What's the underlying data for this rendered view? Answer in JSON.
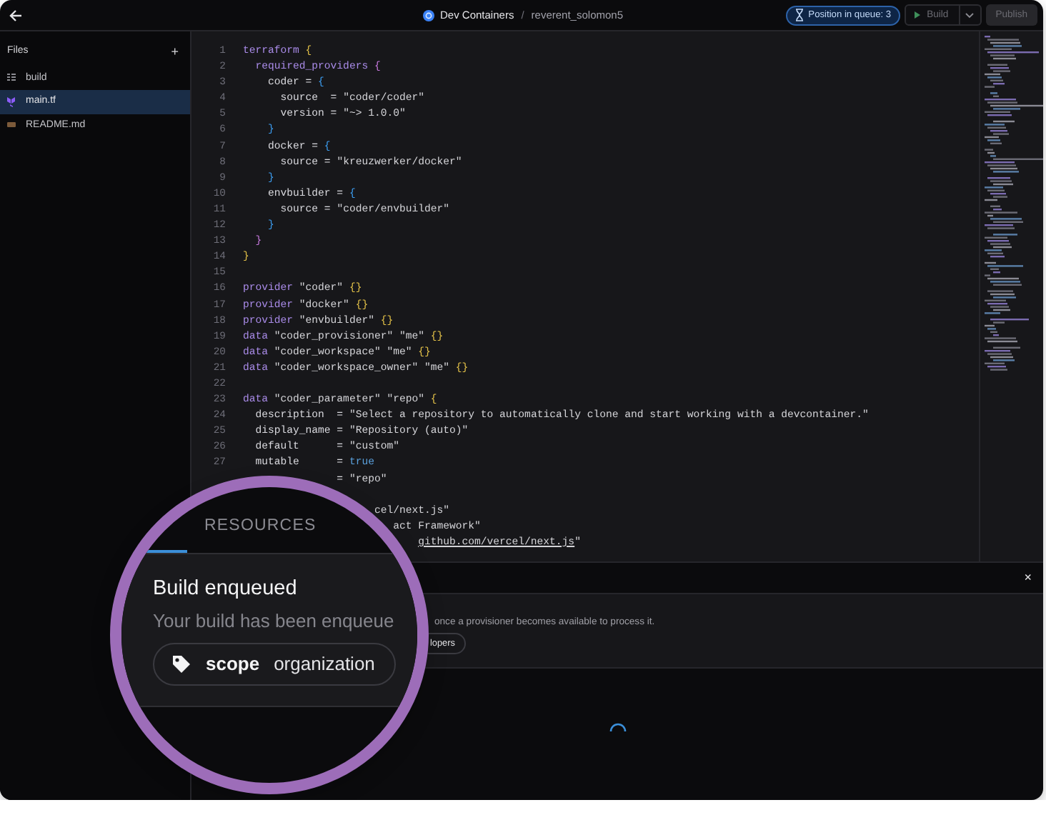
{
  "topbar": {
    "template": "Dev Containers",
    "separator": "/",
    "workspace": "reverent_solomon5",
    "queue_badge": "Position in queue: 3",
    "build_button": {
      "label": "Build",
      "disabled": true
    },
    "publish_button": {
      "label": "Publish",
      "disabled": true
    }
  },
  "sidebar": {
    "title": "Files",
    "add_button": "+",
    "files": [
      {
        "name": "build",
        "kind": "folder",
        "selected": false
      },
      {
        "name": "main.tf",
        "kind": "terraform",
        "selected": true
      },
      {
        "name": "README.md",
        "kind": "markdown",
        "selected": false
      }
    ]
  },
  "editor": {
    "lines": [
      {
        "number": "1",
        "tokens": [
          {
            "text": "terraform",
            "kind": "keyword"
          },
          {
            "text": " {",
            "kind": "brace",
            "color": "#e2c048"
          }
        ]
      },
      {
        "number": "2",
        "tokens": [
          {
            "text": "  required_providers",
            "kind": "keyword"
          },
          {
            "text": " {",
            "kind": "brace",
            "color": "#c678dd"
          }
        ]
      },
      {
        "number": "3",
        "tokens": [
          {
            "text": "    coder =",
            "kind": "plain"
          },
          {
            "text": " {",
            "kind": "brace",
            "color": "#3c9df0"
          }
        ]
      },
      {
        "number": "4",
        "tokens": [
          {
            "text": "      source  = ",
            "kind": "plain"
          },
          {
            "text": "\"coder/coder\"",
            "kind": "string"
          }
        ]
      },
      {
        "number": "5",
        "tokens": [
          {
            "text": "      version = ",
            "kind": "plain"
          },
          {
            "text": "\"~> 1.0.0\"",
            "kind": "string"
          }
        ]
      },
      {
        "number": "6",
        "tokens": [
          {
            "text": "    }",
            "kind": "brace",
            "color": "#3c9df0"
          }
        ]
      },
      {
        "number": "7",
        "tokens": [
          {
            "text": "    docker =",
            "kind": "plain"
          },
          {
            "text": " {",
            "kind": "brace",
            "color": "#3c9df0"
          }
        ]
      },
      {
        "number": "8",
        "tokens": [
          {
            "text": "      source = ",
            "kind": "plain"
          },
          {
            "text": "\"kreuzwerker/docker\"",
            "kind": "string"
          }
        ]
      },
      {
        "number": "9",
        "tokens": [
          {
            "text": "    }",
            "kind": "brace",
            "color": "#3c9df0"
          }
        ]
      },
      {
        "number": "10",
        "tokens": [
          {
            "text": "    envbuilder =",
            "kind": "plain"
          },
          {
            "text": " {",
            "kind": "brace",
            "color": "#3c9df0"
          }
        ]
      },
      {
        "number": "11",
        "tokens": [
          {
            "text": "      source = ",
            "kind": "plain"
          },
          {
            "text": "\"coder/envbuilder\"",
            "kind": "string"
          }
        ]
      },
      {
        "number": "12",
        "tokens": [
          {
            "text": "    }",
            "kind": "brace",
            "color": "#3c9df0"
          }
        ]
      },
      {
        "number": "13",
        "tokens": [
          {
            "text": "  }",
            "kind": "brace",
            "color": "#c678dd"
          }
        ]
      },
      {
        "number": "14",
        "tokens": [
          {
            "text": "}",
            "kind": "brace",
            "color": "#e2c048"
          }
        ]
      },
      {
        "number": "15"
      },
      {
        "number": "16",
        "tokens": [
          {
            "text": "provider",
            "kind": "keyword"
          },
          {
            "text": " \"coder\" ",
            "kind": "string"
          },
          {
            "text": "{}",
            "kind": "brace",
            "color": "#e2c048"
          }
        ]
      },
      {
        "number": "17",
        "tokens": [
          {
            "text": "provider",
            "kind": "keyword"
          },
          {
            "text": " \"docker\" ",
            "kind": "string"
          },
          {
            "text": "{}",
            "kind": "brace",
            "color": "#e2c048"
          }
        ]
      },
      {
        "number": "18",
        "tokens": [
          {
            "text": "provider",
            "kind": "keyword"
          },
          {
            "text": " \"envbuilder\" ",
            "kind": "string"
          },
          {
            "text": "{}",
            "kind": "brace",
            "color": "#e2c048"
          }
        ]
      },
      {
        "number": "19",
        "tokens": [
          {
            "text": "data",
            "kind": "keyword"
          },
          {
            "text": " \"coder_provisioner\" \"me\" ",
            "kind": "string"
          },
          {
            "text": "{}",
            "kind": "brace",
            "color": "#e2c048"
          }
        ]
      },
      {
        "number": "20",
        "tokens": [
          {
            "text": "data",
            "kind": "keyword"
          },
          {
            "text": " \"coder_workspace\" \"me\" ",
            "kind": "string"
          },
          {
            "text": "{}",
            "kind": "brace",
            "color": "#e2c048"
          }
        ]
      },
      {
        "number": "21",
        "tokens": [
          {
            "text": "data",
            "kind": "keyword"
          },
          {
            "text": " \"coder_workspace_owner\" \"me\" ",
            "kind": "string"
          },
          {
            "text": "{}",
            "kind": "brace",
            "color": "#e2c048"
          }
        ]
      },
      {
        "number": "22"
      },
      {
        "number": "23",
        "tokens": [
          {
            "text": "data",
            "kind": "keyword"
          },
          {
            "text": " \"coder_parameter\" \"repo\" ",
            "kind": "string"
          },
          {
            "text": "{",
            "kind": "brace",
            "color": "#e2c048"
          }
        ]
      },
      {
        "number": "24",
        "tokens": [
          {
            "text": "  description  = ",
            "kind": "plain"
          },
          {
            "text": "\"Select a repository to automatically clone and start working with a devcontainer.\"",
            "kind": "string"
          }
        ]
      },
      {
        "number": "25",
        "tokens": [
          {
            "text": "  display_name = ",
            "kind": "plain"
          },
          {
            "text": "\"Repository (auto)\"",
            "kind": "string"
          }
        ]
      },
      {
        "number": "26",
        "tokens": [
          {
            "text": "  default      = ",
            "kind": "plain"
          },
          {
            "text": "\"custom\"",
            "kind": "string"
          }
        ]
      },
      {
        "number": "27",
        "tokens": [
          {
            "text": "  mutable      = ",
            "kind": "plain"
          },
          {
            "text": "true",
            "kind": "boolean"
          }
        ]
      },
      {
        "tokens": [
          {
            "text": "= ",
            "kind": "plain"
          },
          {
            "text": "\"repo\"",
            "kind": "string"
          }
        ]
      },
      {
        "tokens": [
          {
            "text": "cel/next.js\"",
            "kind": "string"
          }
        ]
      },
      {
        "tokens": [
          {
            "text": "act Framework\"",
            "kind": "string"
          }
        ]
      },
      {
        "tokens": [
          {
            "text": "github.com/vercel/next.js",
            "kind": "link"
          },
          {
            "text": "\"",
            "kind": "string"
          }
        ]
      }
    ]
  },
  "bottom_panel": {
    "close_button": "×",
    "message": "once a provisioner becomes available to process it.",
    "chip": "lopers"
  },
  "magnifier": {
    "tabs": [
      {
        "selected": true
      },
      {
        "label": "RESOURCES",
        "selected": false
      }
    ],
    "title": "Build enqueued",
    "message": "Your build has been enqueue",
    "tag": {
      "key": "scope",
      "value": "organization"
    }
  }
}
